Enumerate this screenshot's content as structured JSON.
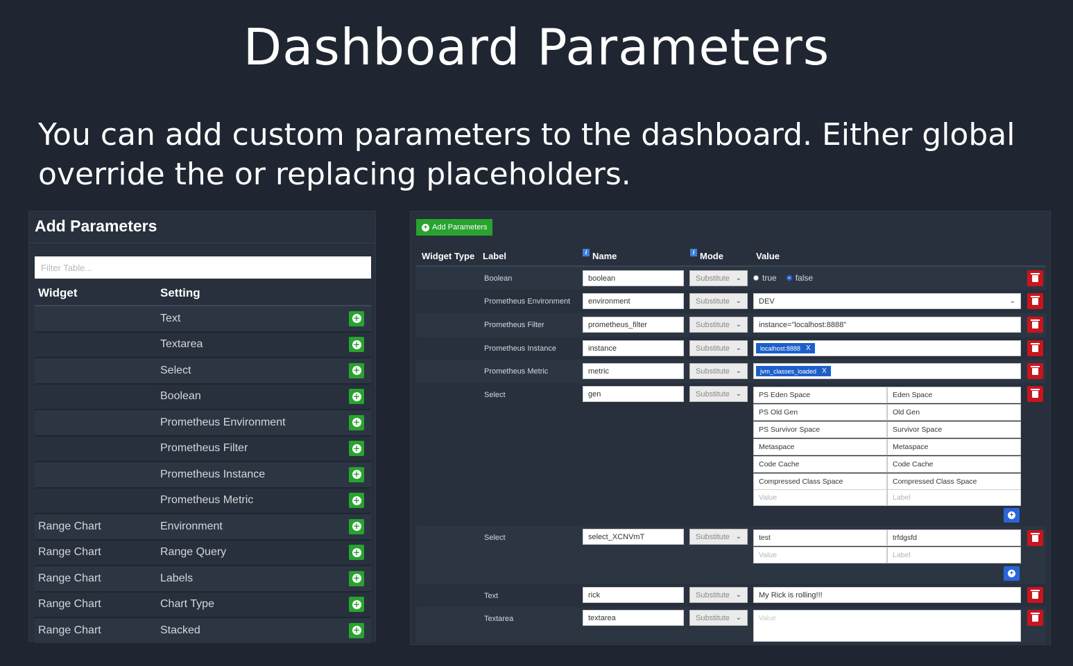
{
  "slide": {
    "title": "Dashboard Parameters",
    "subtitle_line1": "You can add custom parameters to the dashboard. Either global",
    "subtitle_line2": "override the or replacing placeholders."
  },
  "left_panel": {
    "title": "Add Parameters",
    "filter_placeholder": "Filter Table...",
    "col_widget": "Widget",
    "col_setting": "Setting",
    "rows": [
      {
        "widget": "",
        "setting": "Text"
      },
      {
        "widget": "",
        "setting": "Textarea"
      },
      {
        "widget": "",
        "setting": "Select"
      },
      {
        "widget": "",
        "setting": "Boolean"
      },
      {
        "widget": "",
        "setting": "Prometheus Environment"
      },
      {
        "widget": "",
        "setting": "Prometheus Filter"
      },
      {
        "widget": "",
        "setting": "Prometheus Instance"
      },
      {
        "widget": "",
        "setting": "Prometheus Metric"
      },
      {
        "widget": "Range Chart",
        "setting": "Environment"
      },
      {
        "widget": "Range Chart",
        "setting": "Range Query"
      },
      {
        "widget": "Range Chart",
        "setting": "Labels"
      },
      {
        "widget": "Range Chart",
        "setting": "Chart Type"
      },
      {
        "widget": "Range Chart",
        "setting": "Stacked"
      }
    ]
  },
  "right_panel": {
    "add_button": "Add Parameters",
    "headers": {
      "widget_type": "Widget Type",
      "label": "Label",
      "name": "Name",
      "mode": "Mode",
      "value": "Value"
    },
    "mode_value": "Substitute",
    "boolean_row": {
      "label": "Boolean",
      "name": "boolean",
      "true_label": "true",
      "false_label": "false"
    },
    "env_row": {
      "label": "Prometheus Environment",
      "name": "environment",
      "value": "DEV"
    },
    "filter_row": {
      "label": "Prometheus Filter",
      "name": "prometheus_filter",
      "value": "instance=\"localhost:8888\""
    },
    "instance_row": {
      "label": "Prometheus Instance",
      "name": "instance",
      "tag": "localhost:8888",
      "tag_x": "X"
    },
    "metric_row": {
      "label": "Prometheus Metric",
      "name": "metric",
      "tag": "jvm_classes_loaded",
      "tag_x": "X"
    },
    "select_row": {
      "label": "Select",
      "name": "gen",
      "options": [
        {
          "value": "PS Eden Space",
          "label": "Eden Space"
        },
        {
          "value": "PS Old Gen",
          "label": "Old Gen"
        },
        {
          "value": "PS Survivor Space",
          "label": "Survivor Space"
        },
        {
          "value": "Metaspace",
          "label": "Metaspace"
        },
        {
          "value": "Code Cache",
          "label": "Code Cache"
        },
        {
          "value": "Compressed Class Space",
          "label": "Compressed Class Space"
        }
      ],
      "value_placeholder": "Value",
      "label_placeholder": "Label"
    },
    "select_row2": {
      "label": "Select",
      "name": "select_XCNVmT",
      "options": [
        {
          "value": "test",
          "label": "trfdgsfd"
        }
      ],
      "value_placeholder": "Value",
      "label_placeholder": "Label"
    },
    "text_row": {
      "label": "Text",
      "name": "rick",
      "value": "My Rick is rolling!!!"
    },
    "textarea_row": {
      "label": "Textarea",
      "name": "textarea",
      "placeholder": "Value"
    }
  }
}
